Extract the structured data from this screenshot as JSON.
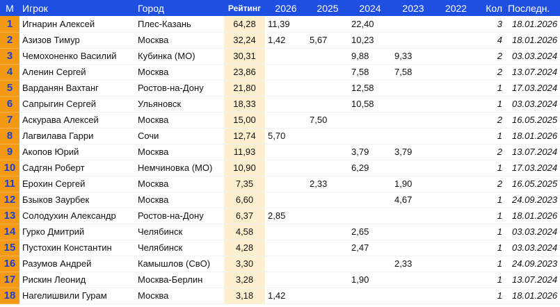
{
  "columns": {
    "m": "М",
    "player": "Игрок",
    "city": "Город",
    "rating": "Рейтинг",
    "y2026": "2026",
    "y2025": "2025",
    "y2024": "2024",
    "y2023": "2023",
    "y2022": "2022",
    "kol": "Кол",
    "last": "Последн."
  },
  "rows": [
    {
      "m": "1",
      "player": "Игнарин Алексей",
      "city": "Плес-Казань",
      "rating": "64,28",
      "y2026": "11,39",
      "y2025": "",
      "y2024": "22,40",
      "y2023": "",
      "y2022": "",
      "kol": "3",
      "last": "18.01.2026"
    },
    {
      "m": "2",
      "player": "Азизов Тимур",
      "city": "Москва",
      "rating": "32,24",
      "y2026": "1,42",
      "y2025": "5,67",
      "y2024": "10,23",
      "y2023": "",
      "y2022": "",
      "kol": "4",
      "last": "18.01.2026"
    },
    {
      "m": "3",
      "player": "Чемохоненко Василий",
      "city": "Кубинка (МО)",
      "rating": "30,31",
      "y2026": "",
      "y2025": "",
      "y2024": "9,88",
      "y2023": "9,33",
      "y2022": "",
      "kol": "2",
      "last": "03.03.2024"
    },
    {
      "m": "4",
      "player": "Аленин Сергей",
      "city": "Москва",
      "rating": "23,86",
      "y2026": "",
      "y2025": "",
      "y2024": "7,58",
      "y2023": "7,58",
      "y2022": "",
      "kol": "2",
      "last": "13.07.2024"
    },
    {
      "m": "5",
      "player": "Варданян Вахтанг",
      "city": "Ростов-на-Дону",
      "rating": "21,80",
      "y2026": "",
      "y2025": "",
      "y2024": "12,58",
      "y2023": "",
      "y2022": "",
      "kol": "1",
      "last": "17.03.2024"
    },
    {
      "m": "6",
      "player": "Сапрыгин Сергей",
      "city": "Ульяновск",
      "rating": "18,33",
      "y2026": "",
      "y2025": "",
      "y2024": "10,58",
      "y2023": "",
      "y2022": "",
      "kol": "1",
      "last": "03.03.2024"
    },
    {
      "m": "7",
      "player": "Аскурава Алексей",
      "city": "Москва",
      "rating": "15,00",
      "y2026": "",
      "y2025": "7,50",
      "y2024": "",
      "y2023": "",
      "y2022": "",
      "kol": "2",
      "last": "16.05.2025"
    },
    {
      "m": "8",
      "player": "Лагвилава Гарри",
      "city": "Сочи",
      "rating": "12,74",
      "y2026": "5,70",
      "y2025": "",
      "y2024": "",
      "y2023": "",
      "y2022": "",
      "kol": "1",
      "last": "18.01.2026"
    },
    {
      "m": "9",
      "player": "Акопов Юрий",
      "city": "Москва",
      "rating": "11,93",
      "y2026": "",
      "y2025": "",
      "y2024": "3,79",
      "y2023": "3,79",
      "y2022": "",
      "kol": "2",
      "last": "13.07.2024"
    },
    {
      "m": "10",
      "player": "Садгян Роберт",
      "city": "Немчиновка (МО)",
      "rating": "10,90",
      "y2026": "",
      "y2025": "",
      "y2024": "6,29",
      "y2023": "",
      "y2022": "",
      "kol": "1",
      "last": "17.03.2024"
    },
    {
      "m": "11",
      "player": "Ерохин Сергей",
      "city": "Москва",
      "rating": "7,35",
      "y2026": "",
      "y2025": "2,33",
      "y2024": "",
      "y2023": "1,90",
      "y2022": "",
      "kol": "2",
      "last": "16.05.2025"
    },
    {
      "m": "12",
      "player": "Бзыков Заурбек",
      "city": "Москва",
      "rating": "6,60",
      "y2026": "",
      "y2025": "",
      "y2024": "",
      "y2023": "4,67",
      "y2022": "",
      "kol": "1",
      "last": "24.09.2023"
    },
    {
      "m": "13",
      "player": "Солодухин Александр",
      "city": "Ростов-на-Дону",
      "rating": "6,37",
      "y2026": "2,85",
      "y2025": "",
      "y2024": "",
      "y2023": "",
      "y2022": "",
      "kol": "1",
      "last": "18.01.2026"
    },
    {
      "m": "14",
      "player": "Гурко Дмитрий",
      "city": "Челябинск",
      "rating": "4,58",
      "y2026": "",
      "y2025": "",
      "y2024": "2,65",
      "y2023": "",
      "y2022": "",
      "kol": "1",
      "last": "03.03.2024"
    },
    {
      "m": "15",
      "player": "Пустохин Константин",
      "city": "Челябинск",
      "rating": "4,28",
      "y2026": "",
      "y2025": "",
      "y2024": "2,47",
      "y2023": "",
      "y2022": "",
      "kol": "1",
      "last": "03.03.2024"
    },
    {
      "m": "16",
      "player": "Разумов Андрей",
      "city": "Камышлов (СвО)",
      "rating": "3,30",
      "y2026": "",
      "y2025": "",
      "y2024": "",
      "y2023": "2,33",
      "y2022": "",
      "kol": "1",
      "last": "24.09.2023"
    },
    {
      "m": "17",
      "player": "Рискин Леонид",
      "city": "Москва-Берлин",
      "rating": "3,28",
      "y2026": "",
      "y2025": "",
      "y2024": "1,90",
      "y2023": "",
      "y2022": "",
      "kol": "1",
      "last": "13.07.2024"
    },
    {
      "m": "18",
      "player": "Нагелишвили Гурам",
      "city": "Москва",
      "rating": "3,18",
      "y2026": "1,42",
      "y2025": "",
      "y2024": "",
      "y2023": "",
      "y2022": "",
      "kol": "1",
      "last": "18.01.2026"
    }
  ]
}
